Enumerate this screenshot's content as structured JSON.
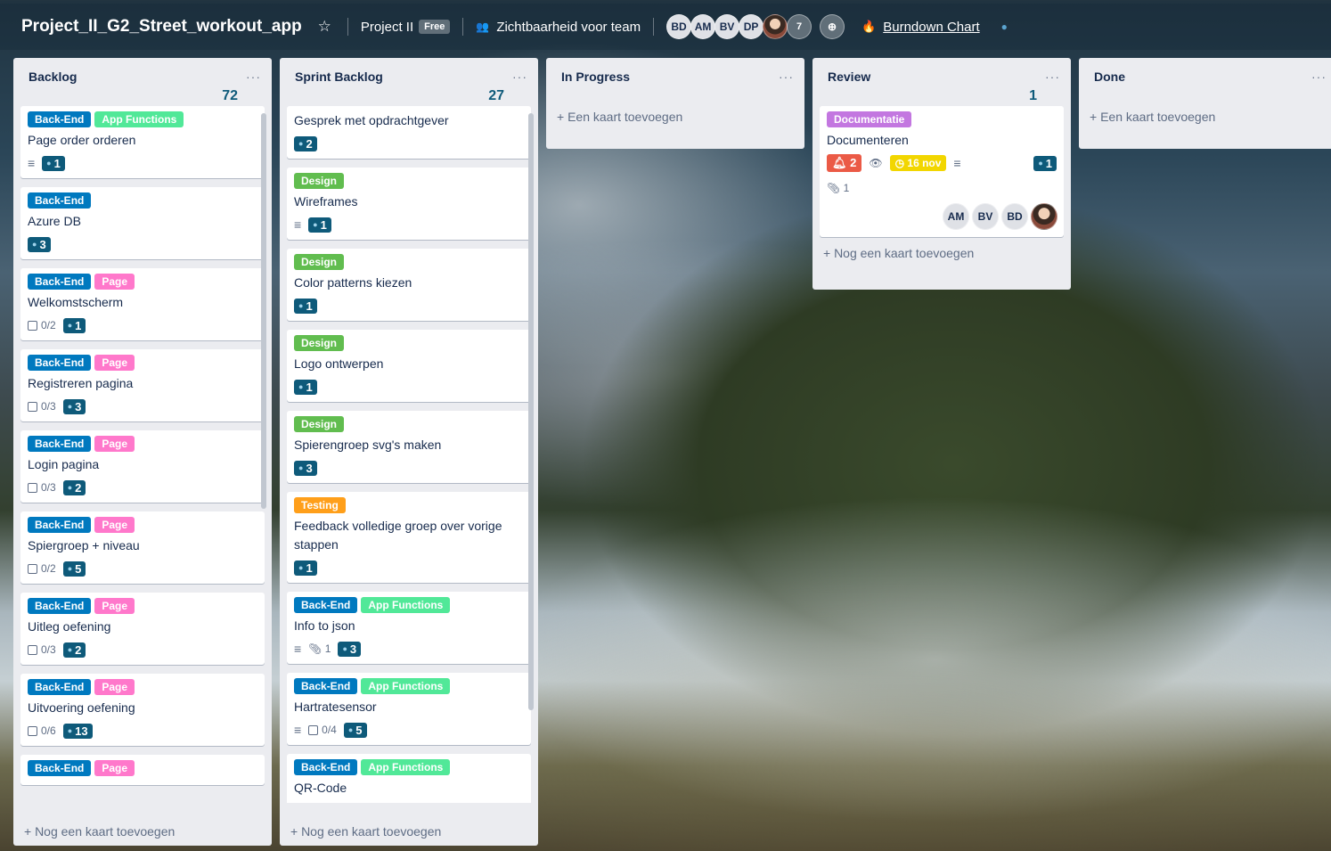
{
  "header": {
    "board_title": "Project_II_G2_Street_workout_app",
    "team": "Project II",
    "team_plan": "Free",
    "visibility": "Zichtbaarheid voor team",
    "members": [
      "BD",
      "AM",
      "BV",
      "DP"
    ],
    "more_members": "7",
    "powerup": "Burndown Chart"
  },
  "colors": {
    "backend": "#0079bf",
    "app_functions": "#51e898",
    "page": "#ff78cb",
    "design": "#61bd4f",
    "testing": "#ff9f1a",
    "documentatie": "#c377e0"
  },
  "lists": {
    "backlog": {
      "name": "Backlog",
      "count": "72",
      "add": "+ Nog een kaart toevoegen",
      "cards": [
        {
          "labels": [
            "Back-End",
            "App Functions"
          ],
          "title": "Page order orderen",
          "desc": true,
          "checklist": "",
          "plugin": "1"
        },
        {
          "labels": [
            "Back-End"
          ],
          "title": "Azure DB",
          "desc": false,
          "checklist": "",
          "plugin": "3"
        },
        {
          "labels": [
            "Back-End",
            "Page"
          ],
          "title": "Welkomstscherm",
          "desc": false,
          "checklist": "0/2",
          "plugin": "1"
        },
        {
          "labels": [
            "Back-End",
            "Page"
          ],
          "title": "Registreren pagina",
          "desc": false,
          "checklist": "0/3",
          "plugin": "3"
        },
        {
          "labels": [
            "Back-End",
            "Page"
          ],
          "title": "Login pagina",
          "desc": false,
          "checklist": "0/3",
          "plugin": "2"
        },
        {
          "labels": [
            "Back-End",
            "Page"
          ],
          "title": "Spiergroep + niveau",
          "desc": false,
          "checklist": "0/2",
          "plugin": "5"
        },
        {
          "labels": [
            "Back-End",
            "Page"
          ],
          "title": "Uitleg oefening",
          "desc": false,
          "checklist": "0/3",
          "plugin": "2"
        },
        {
          "labels": [
            "Back-End",
            "Page"
          ],
          "title": "Uitvoering oefening",
          "desc": false,
          "checklist": "0/6",
          "plugin": "13"
        },
        {
          "labels": [
            "Back-End",
            "Page"
          ],
          "title": "",
          "desc": false,
          "checklist": "",
          "plugin": ""
        }
      ]
    },
    "sprint": {
      "name": "Sprint Backlog",
      "count": "27",
      "add": "+ Nog een kaart toevoegen",
      "cards": [
        {
          "labels": [],
          "title": "Gesprek met opdrachtgever",
          "desc": false,
          "checklist": "",
          "plugin": "2"
        },
        {
          "labels": [
            "Design"
          ],
          "title": "Wireframes",
          "desc": true,
          "checklist": "",
          "plugin": "1"
        },
        {
          "labels": [
            "Design"
          ],
          "title": "Color patterns kiezen",
          "desc": false,
          "checklist": "",
          "plugin": "1"
        },
        {
          "labels": [
            "Design"
          ],
          "title": "Logo ontwerpen",
          "desc": false,
          "checklist": "",
          "plugin": "1"
        },
        {
          "labels": [
            "Design"
          ],
          "title": "Spierengroep svg's maken",
          "desc": false,
          "checklist": "",
          "plugin": "3"
        },
        {
          "labels": [
            "Testing"
          ],
          "title": "Feedback volledige groep over vorige stappen",
          "desc": false,
          "checklist": "",
          "plugin": "1"
        },
        {
          "labels": [
            "Back-End",
            "App Functions"
          ],
          "title": "Info to json",
          "desc": true,
          "attachments": "1",
          "checklist": "",
          "plugin": "3"
        },
        {
          "labels": [
            "Back-End",
            "App Functions"
          ],
          "title": "Hartratesensor",
          "desc": true,
          "checklist": "0/4",
          "plugin": "5"
        },
        {
          "labels": [
            "Back-End",
            "App Functions"
          ],
          "title": "QR-Code",
          "desc": false,
          "checklist": "",
          "plugin": ""
        }
      ]
    },
    "inprogress": {
      "name": "In Progress",
      "add": "+ Een kaart toevoegen"
    },
    "review": {
      "name": "Review",
      "count": "1",
      "add": "+ Nog een kaart toevoegen",
      "card": {
        "label": "Documentatie",
        "title": "Documenteren",
        "notifications": "2",
        "due": "16 nov",
        "attachments": "1",
        "plugin": "1",
        "members": [
          "AM",
          "BV",
          "BD"
        ]
      }
    },
    "done": {
      "name": "Done",
      "add": "+ Een kaart toevoegen"
    }
  }
}
